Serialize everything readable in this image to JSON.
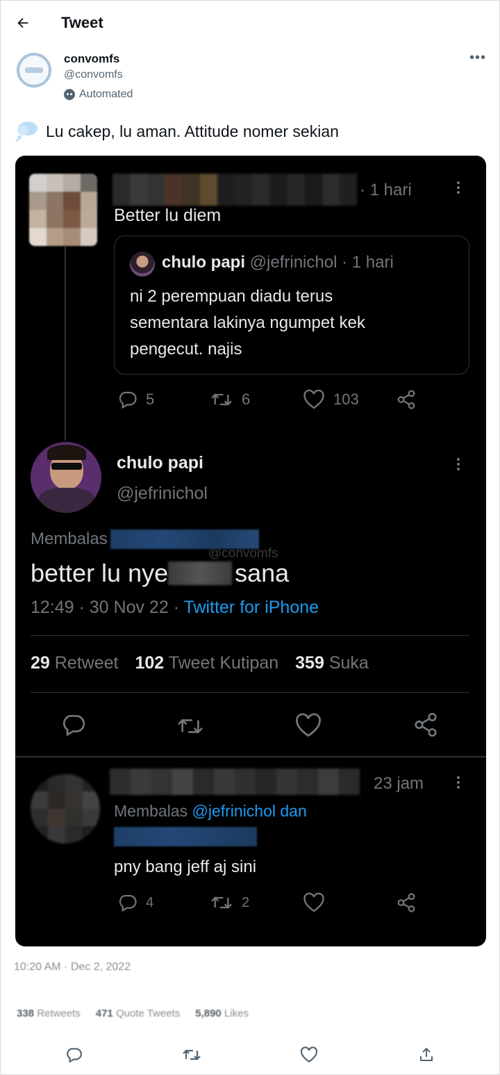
{
  "header": {
    "title": "Tweet"
  },
  "author": {
    "name": "convomfs",
    "handle": "@convomfs",
    "automated_label": "Automated"
  },
  "tweet": {
    "text": "Lu cakep, lu aman. Attitude nomer sekian"
  },
  "screenshot": {
    "first_reply": {
      "time": "· 1 hari",
      "text": "Better lu diem",
      "quoted": {
        "name": "chulo papi",
        "handle": "@jefrinichol",
        "time": "· 1 hari",
        "text_line1": "ni 2 perempuan diadu terus",
        "text_line2": "sementara lakinya ngumpet kek",
        "text_line3": "pengecut. najis"
      },
      "replies": "5",
      "retweets": "6",
      "likes": "103"
    },
    "main": {
      "name": "chulo papi",
      "handle": "@jefrinichol",
      "replying_label": "Membalas",
      "watermark": "@convomfs",
      "text_start": "better lu nye",
      "text_end": "sana",
      "time": "12:49 · 30 Nov 22 ·",
      "client": "Twitter for iPhone",
      "retweets_count": "29",
      "retweets_label": "Retweet",
      "quotes_count": "102",
      "quotes_label": "Tweet Kutipan",
      "likes_count": "359",
      "likes_label": "Suka"
    },
    "second_reply": {
      "time": "23 jam",
      "replying_label": "Membalas",
      "replying_target": "@jefrinichol dan",
      "text": "pny bang jeff aj sini",
      "replies": "4",
      "retweets": "2"
    }
  },
  "footer": {
    "timestamp": "10:20 AM · Dec 2, 2022",
    "retweets_count": "338",
    "retweets_label": "Retweets",
    "quotes_count": "471",
    "quotes_label": "Quote Tweets",
    "likes_count": "5,890",
    "likes_label": "Likes"
  },
  "colors": {
    "link_blue": "#1d9bf0",
    "dark_bg": "#000000",
    "text_light": "#e7e9ea",
    "muted": "#71767b"
  }
}
